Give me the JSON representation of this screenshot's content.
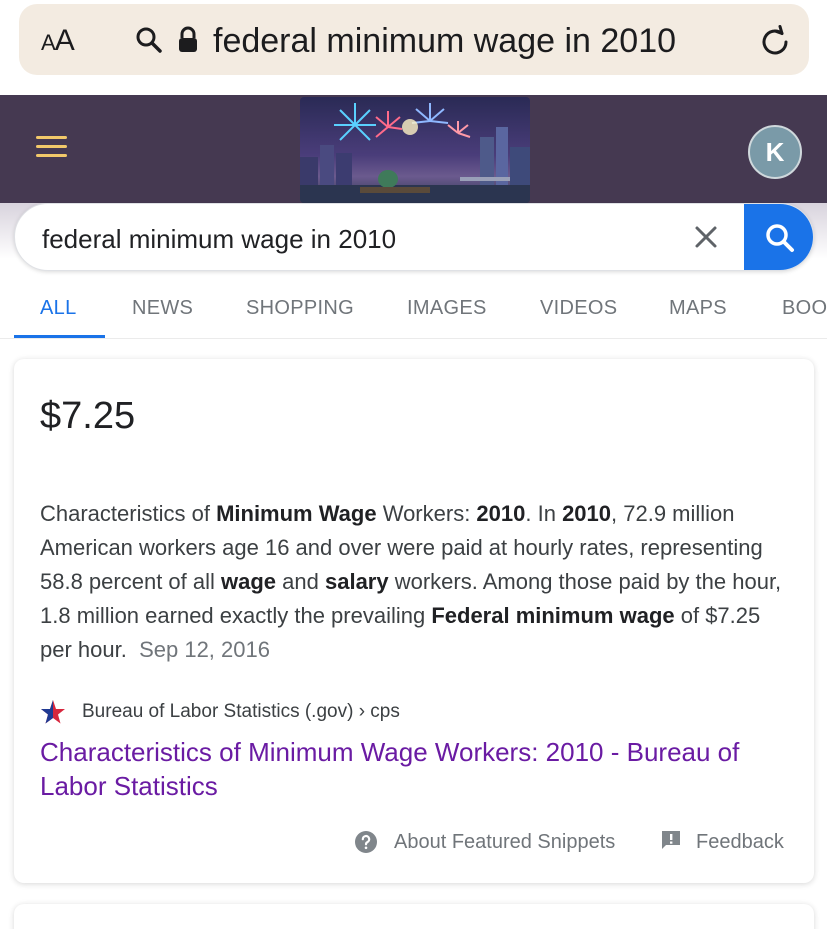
{
  "browser": {
    "text_size_button": {
      "small": "A",
      "large": "A"
    },
    "url_text": "federal minimum wage in 2010"
  },
  "header": {
    "avatar_initial": "K",
    "accent": "#f2c96a",
    "background": "#453951"
  },
  "search": {
    "query": "federal minimum wage in 2010",
    "button_color": "#1a73e8"
  },
  "tabs": [
    {
      "label": "ALL",
      "active": true
    },
    {
      "label": "NEWS"
    },
    {
      "label": "SHOPPING"
    },
    {
      "label": "IMAGES"
    },
    {
      "label": "VIDEOS"
    },
    {
      "label": "MAPS"
    },
    {
      "label": "BOO"
    }
  ],
  "featured_snippet": {
    "answer": "$7.25",
    "snippet": {
      "t1": "Characteristics of ",
      "b1": "Minimum Wage",
      "t2": " Workers: ",
      "b2": "2010",
      "t3": ". In ",
      "b3": "2010",
      "t4": ", 72.9 million American workers age 16 and over were paid at hourly rates, representing 58.8 percent of all ",
      "b4": "wage",
      "t5": " and ",
      "b5": "salary",
      "t6": " workers. Among those paid by the hour, 1.8 million earned exactly the prevailing ",
      "b6": "Federal minimum wage",
      "t7": " of $7.25 per hour.",
      "date": "Sep 12, 2016"
    },
    "source": "Bureau of Labor Statistics (.gov) › cps",
    "link_title": "Characteristics of Minimum Wage Workers: 2010 - Bureau of Labor Statistics",
    "link_color": "#6a1ba3",
    "about_label": "About Featured Snippets",
    "feedback_label": "Feedback"
  }
}
